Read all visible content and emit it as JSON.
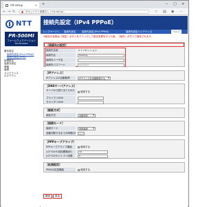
{
  "browser": {
    "tab_title": "ntt.setup",
    "address_warning": "▲",
    "address_text": "セキュリティ保護なし | ntt.setup/...",
    "nav_back": "←",
    "nav_forward": "→",
    "nav_reload": "↻",
    "new_tab": "+",
    "tab_close": "×",
    "win_min": "─",
    "win_max": "□",
    "win_close": "×"
  },
  "sidebar": {
    "brand": "NTT",
    "model": "PR-500MI",
    "firmware_label": "ファームウェアバージョン",
    "firmware_version": "xx.xx.xxxx",
    "menu": [
      {
        "label": "基本設定",
        "type": "head"
      },
      {
        "label": "接続先設定(IPv4 PPPoE)",
        "type": "sub"
      },
      {
        "label": "接続先設定(IPv6)",
        "type": "sub"
      },
      {
        "label": "詳細設定",
        "type": "head"
      },
      {
        "label": "高度な設定",
        "type": "head"
      },
      {
        "label": "情報",
        "type": "head"
      },
      {
        "label": "管理",
        "type": "head"
      },
      {
        "label": "メンテナンス",
        "type": "head"
      },
      {
        "label": "ログアウト",
        "type": "head"
      }
    ]
  },
  "main": {
    "title": "接続先設定（IPv4 PPPoE）",
    "tabs": [
      "トップページへ",
      "接続先設定",
      "接続先設定(IPv4 PPPoE)",
      "接続先設定メンテナンス",
      "ヘルプ"
    ],
    "notice": "※設定の反映は［設定］ボタンをクリックして設定変更を行った後、［保存］ボタンで保存されます。",
    "sections": {
      "connection": {
        "header": "［接続先の設定］",
        "rows": [
          {
            "label": "接続先名前",
            "value": "メインセッション"
          },
          {
            "label": "接続先名",
            "value": "flesetsjp"
          },
          {
            "label": "接続先ユーザ名",
            "value": ""
          },
          {
            "label": "接続先パスワード",
            "value": "••••••••"
          }
        ]
      },
      "ipaddr": {
        "header": "［IPアドレス］",
        "label": "IPアドレスの自動取得",
        "value": "IPアドレスを自動取得する"
      },
      "dns": {
        "header": "［DNSサーバアドレス］",
        "rows": [
          {
            "label": "サーバから割り当てられたアドレス",
            "value": "使用する"
          },
          {
            "label": "プライマリDNS",
            "value": ""
          },
          {
            "label": "セカンダリDNS",
            "value": ""
          }
        ]
      },
      "auth": {
        "header": "［認証方式］",
        "label": "認証方式",
        "value": "自動判別"
      },
      "mode": {
        "header": "［接続モード］",
        "rows": [
          {
            "label": "接続モード",
            "value": "常時接続"
          },
          {
            "label": "自動切断するまでの時間(分)",
            "value": ""
          }
        ]
      },
      "keepalive": {
        "header": "［PPPキープアライブ］",
        "rows": [
          {
            "label": "PPPキープアライブ機能",
            "value": "使用する"
          },
          {
            "label": "LCP ECHO送信間隔(秒)",
            "value": "10"
          },
          {
            "label": "LCP ECHOリトライ回数",
            "value": "6"
          }
        ]
      },
      "extension": {
        "header": "［拡張設定］",
        "label": "PINGの応答機能",
        "value": "使用する"
      }
    },
    "buttons": {
      "set": "設定",
      "cancel": "戻る"
    }
  }
}
